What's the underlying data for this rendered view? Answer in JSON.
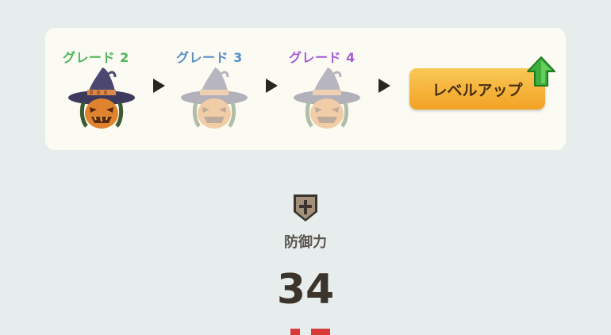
{
  "grades": [
    {
      "label": "グレード 2",
      "color": "#4fb357",
      "icon": "witch-pumpkin-hat-icon",
      "state": "current"
    },
    {
      "label": "グレード 3",
      "color": "#5a8fc4",
      "icon": "witch-pumpkin-hat-icon",
      "state": "locked"
    },
    {
      "label": "グレード 4",
      "color": "#a65bd6",
      "icon": "witch-pumpkin-hat-icon",
      "state": "locked"
    }
  ],
  "level_up": {
    "label": "レベルアップ",
    "icon": "green-up-arrow-icon"
  },
  "stat": {
    "icon": "shield-plus-icon",
    "label": "防御力",
    "value": "34"
  },
  "colors": {
    "button": "#f4aa2e",
    "panel": "#fbfbf3",
    "background": "#e7ecec"
  }
}
